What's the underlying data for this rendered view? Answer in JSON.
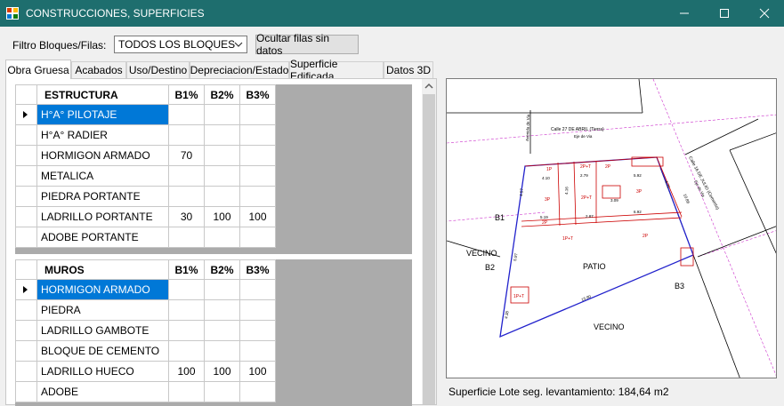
{
  "window": {
    "title": "CONSTRUCCIONES, SUPERFICIES"
  },
  "filter": {
    "label": "Filtro Bloques/Filas:",
    "selected": "TODOS LOS BLOQUES",
    "hide_button": "Ocultar filas sin datos"
  },
  "tabs": [
    "Obra Gruesa",
    "Acabados",
    "Uso/Destino",
    "Depreciacion/Estado",
    "Superficie Edificada",
    "Datos 3D"
  ],
  "grid1": {
    "columns": [
      "ESTRUCTURA",
      "B1%",
      "B2%",
      "B3%"
    ],
    "rows": [
      [
        "H°A° PILOTAJE",
        "",
        "",
        ""
      ],
      [
        "H°A° RADIER",
        "",
        "",
        ""
      ],
      [
        "HORMIGON ARMADO",
        "70",
        "",
        ""
      ],
      [
        "METALICA",
        "",
        "",
        ""
      ],
      [
        "PIEDRA PORTANTE",
        "",
        "",
        ""
      ],
      [
        "LADRILLO PORTANTE",
        "30",
        "100",
        "100"
      ],
      [
        "ADOBE PORTANTE",
        "",
        "",
        ""
      ]
    ]
  },
  "grid2": {
    "columns": [
      "MUROS",
      "B1%",
      "B2%",
      "B3%"
    ],
    "rows": [
      [
        "HORMIGON ARMADO",
        "",
        "",
        ""
      ],
      [
        "PIEDRA",
        "",
        "",
        ""
      ],
      [
        "LADRILLO GAMBOTE",
        "",
        "",
        ""
      ],
      [
        "BLOQUE DE CEMENTO",
        "",
        "",
        ""
      ],
      [
        "LADRILLO HUECO",
        "100",
        "100",
        "100"
      ],
      [
        "ADOBE",
        "",
        "",
        ""
      ]
    ]
  },
  "map": {
    "street_top": "Calle 27 DE ABRIL (Tierra)",
    "axis_top": "Eje de Via",
    "street_right": "Calle 16 DE JULIO (Cemento)",
    "axis_right": "Eje de Via",
    "street_left": "Avenida de Via",
    "labels": {
      "b1": "B1",
      "b2": "B2",
      "b3": "B3",
      "vecino_left": "VECINO",
      "vecino_bottom": "VECINO",
      "patio": "PATIO"
    },
    "rooms": [
      "1P",
      "2P",
      "3P",
      "2P+T",
      "3P",
      "2P",
      "2P",
      "1P+T",
      "2P+T",
      "1P+T"
    ],
    "measures": [
      "4.10",
      "2.79",
      "4.16",
      "5.19",
      "6.92",
      "2.87",
      "10.88",
      "15.90",
      "5.97",
      "4.71",
      "4.57",
      "5.92",
      "3.09",
      "4.38"
    ]
  },
  "status": "Superficie Lote seg. levantamiento: 184,64 m2"
}
